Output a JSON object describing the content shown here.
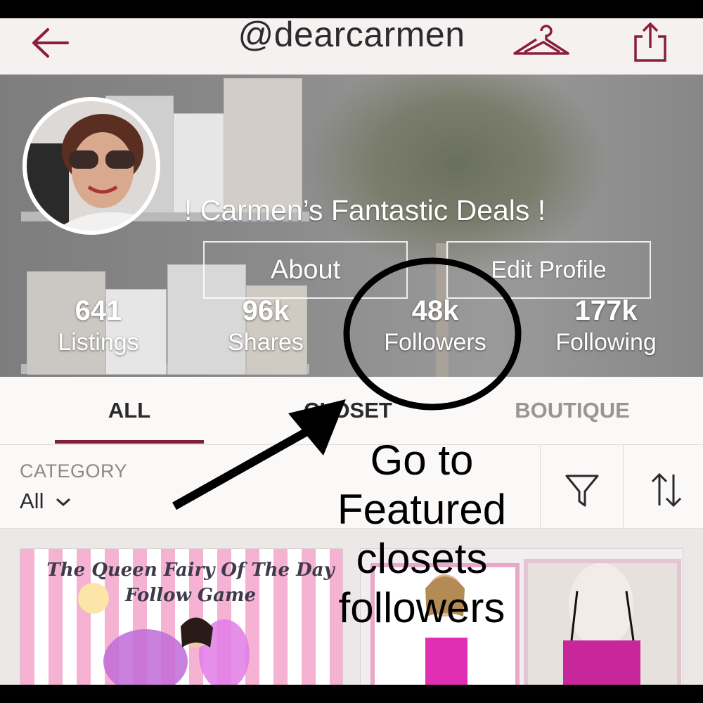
{
  "header": {
    "title": "@dearcarmen",
    "back_icon": "back-arrow-icon",
    "hanger_icon": "hanger-icon",
    "share_icon": "share-icon",
    "accent_color": "#8b1f3a"
  },
  "profile": {
    "shop_name": "!  Carmen’s  Fantastic Deals !",
    "about_label": "About",
    "edit_profile_label": "Edit Profile",
    "stats": [
      {
        "value": "641",
        "label": "Listings"
      },
      {
        "value": "96k",
        "label": "Shares"
      },
      {
        "value": "48k",
        "label": "Followers"
      },
      {
        "value": "177k",
        "label": "Following"
      }
    ]
  },
  "tabs": [
    {
      "label": "ALL",
      "active": true
    },
    {
      "label": "CLOSET",
      "active": false
    },
    {
      "label": "BOUTIQUE",
      "active": false
    }
  ],
  "filter": {
    "category_label": "CATEGORY",
    "category_value": "All",
    "filter_icon": "funnel-icon",
    "sort_icon": "sort-arrows-icon"
  },
  "listings": [
    {
      "headline": "The Queen Fairy Of The Day Follow Game"
    },
    {
      "headline": ""
    }
  ],
  "annotation": {
    "lines": [
      "Go to",
      "Featured",
      "closets",
      "followers"
    ]
  }
}
